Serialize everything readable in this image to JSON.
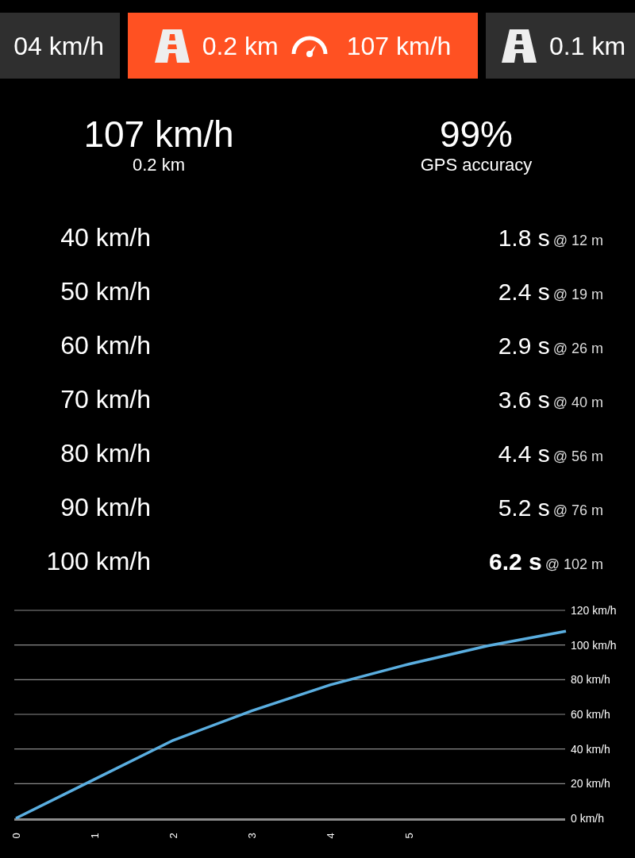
{
  "tabs": [
    {
      "speed": "04 km/h",
      "selected": false
    },
    {
      "distance": "0.2 km",
      "speed": "107 km/h",
      "selected": true
    },
    {
      "distance": "0.1 km",
      "selected": false
    }
  ],
  "summary": [
    {
      "value": "107 km/h",
      "label": "0.2 km"
    },
    {
      "value": "99%",
      "label": "GPS accuracy"
    }
  ],
  "splits": [
    {
      "speed": "40 km/h",
      "time": "1.8 s",
      "distance": "@ 12 m",
      "highlighted": false
    },
    {
      "speed": "50 km/h",
      "time": "2.4 s",
      "distance": "@ 19 m",
      "highlighted": false
    },
    {
      "speed": "60 km/h",
      "time": "2.9 s",
      "distance": "@ 26 m",
      "highlighted": false
    },
    {
      "speed": "70 km/h",
      "time": "3.6 s",
      "distance": "@ 40 m",
      "highlighted": false
    },
    {
      "speed": "80 km/h",
      "time": "4.4 s",
      "distance": "@ 56 m",
      "highlighted": false
    },
    {
      "speed": "90 km/h",
      "time": "5.2 s",
      "distance": "@ 76 m",
      "highlighted": false
    },
    {
      "speed": "100 km/h",
      "time": "6.2 s",
      "distance": "@ 102 m",
      "highlighted": true
    }
  ],
  "chart": {
    "chart_data": {
      "type": "line",
      "x": [
        0,
        1,
        2,
        3,
        4,
        5,
        6,
        7
      ],
      "grid": true,
      "series": [
        {
          "color": "#5aaee0",
          "values": [
            0,
            22.5,
            45,
            62,
            77,
            89,
            99.5,
            108
          ]
        }
      ],
      "xlim": [
        0,
        7
      ],
      "ylim": [
        0,
        120
      ],
      "xticks": [
        0,
        1,
        2,
        3,
        4,
        5
      ],
      "yticks": [
        {
          "value": 0,
          "label": "0 km/h"
        },
        {
          "value": 20,
          "label": "20 km/h"
        },
        {
          "value": 40,
          "label": "40 km/h"
        },
        {
          "value": 60,
          "label": "60 km/h"
        },
        {
          "value": 80,
          "label": "80 km/h"
        },
        {
          "value": 100,
          "label": "100 km/h"
        },
        {
          "value": 120,
          "label": "120 km/h"
        }
      ]
    }
  }
}
